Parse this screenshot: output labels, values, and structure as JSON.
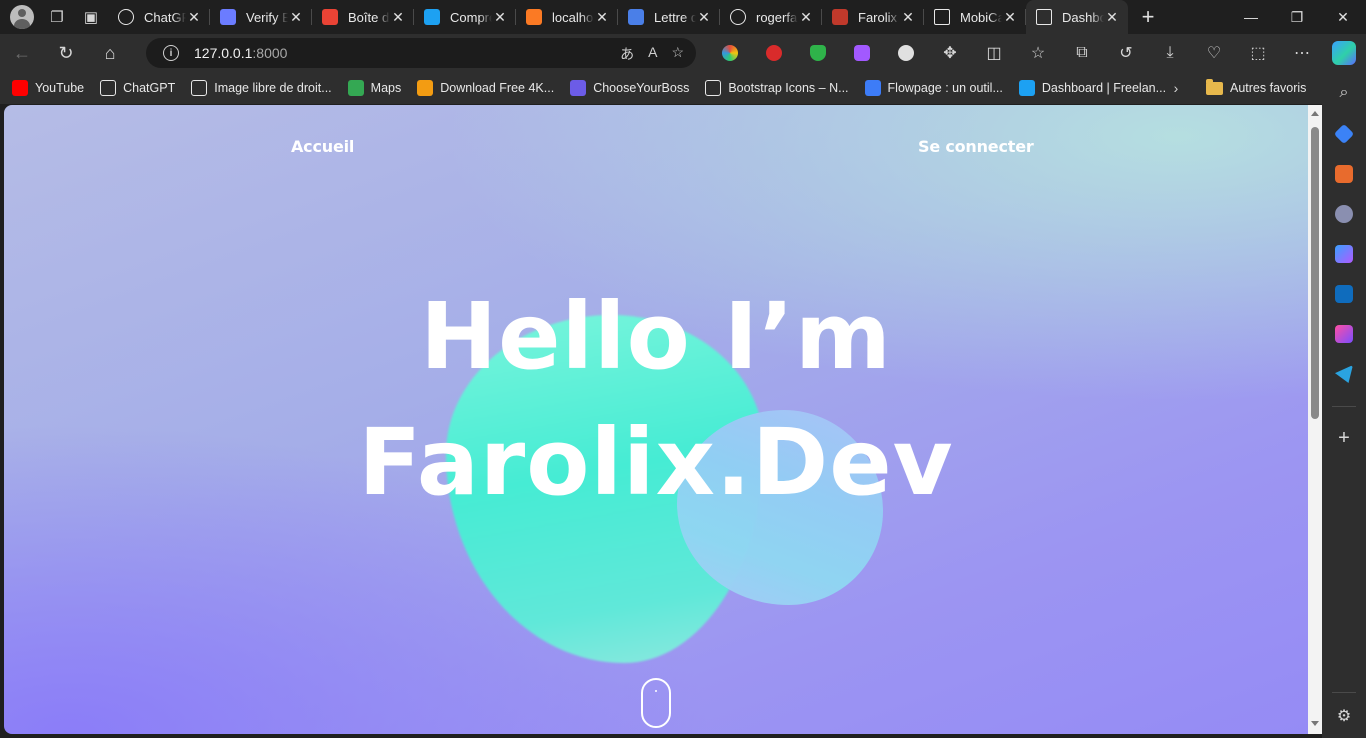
{
  "browser": {
    "tabs": [
      {
        "title": "ChatGPT",
        "favicon": "chatgpt-icon",
        "color": "#ffffff"
      },
      {
        "title": "Verify Email",
        "favicon": "puzzle-icon",
        "color": "#6b7cff"
      },
      {
        "title": "Boîte de réception",
        "favicon": "gmail-icon",
        "color": "#ea4335"
      },
      {
        "title": "Comprendre",
        "favicon": "bird-icon",
        "color": "#1da1f2"
      },
      {
        "title": "localhost",
        "favicon": "xampp-icon",
        "color": "#fb7a24"
      },
      {
        "title": "Lettre de motivation",
        "favicon": "docs-icon",
        "color": "#4a7fe8"
      },
      {
        "title": "rogerfarolix",
        "favicon": "github-icon",
        "color": "#ffffff"
      },
      {
        "title": "Farolix",
        "favicon": "farolix-icon",
        "color": "#c0392b"
      },
      {
        "title": "MobiCash",
        "favicon": "page-icon",
        "color": "#ffffff"
      },
      {
        "title": "Dashboard",
        "favicon": "page-icon",
        "color": "#ffffff"
      }
    ],
    "address": {
      "host": "127.0.0.1",
      "port": ":8000"
    },
    "bookmarks": [
      {
        "label": "YouTube",
        "icon": "youtube-icon",
        "color": "#ff0000"
      },
      {
        "label": "ChatGPT",
        "icon": "chatgpt-icon",
        "color": "#ffffff"
      },
      {
        "label": "Image libre de droit...",
        "icon": "page-icon",
        "color": "#ffffff"
      },
      {
        "label": "Maps",
        "icon": "maps-icon",
        "color": "#34a853"
      },
      {
        "label": "Download Free 4K...",
        "icon": "p-icon",
        "color": "#f39c12"
      },
      {
        "label": "ChooseYourBoss",
        "icon": "cyb-icon",
        "color": "#6c5ce7"
      },
      {
        "label": "Bootstrap Icons – N...",
        "icon": "f-icon",
        "color": "#ffffff"
      },
      {
        "label": "Flowpage : un outil...",
        "icon": "flowpage-icon",
        "color": "#3d7cf7"
      },
      {
        "label": "Dashboard | Freelan...",
        "icon": "bird-icon",
        "color": "#1da1f2"
      }
    ],
    "other_favorites": "Autres favoris"
  },
  "site": {
    "nav_home": "Accueil",
    "nav_login": "Se connecter",
    "hero_line1": "Hello I’m",
    "hero_line2": "Farolix.Dev"
  },
  "colors": {
    "blob_teal": "#46ecd4",
    "blob_blue": "#93cdf4",
    "bg_purple": "#958bf5",
    "bg_mint": "#b6e1e0"
  }
}
